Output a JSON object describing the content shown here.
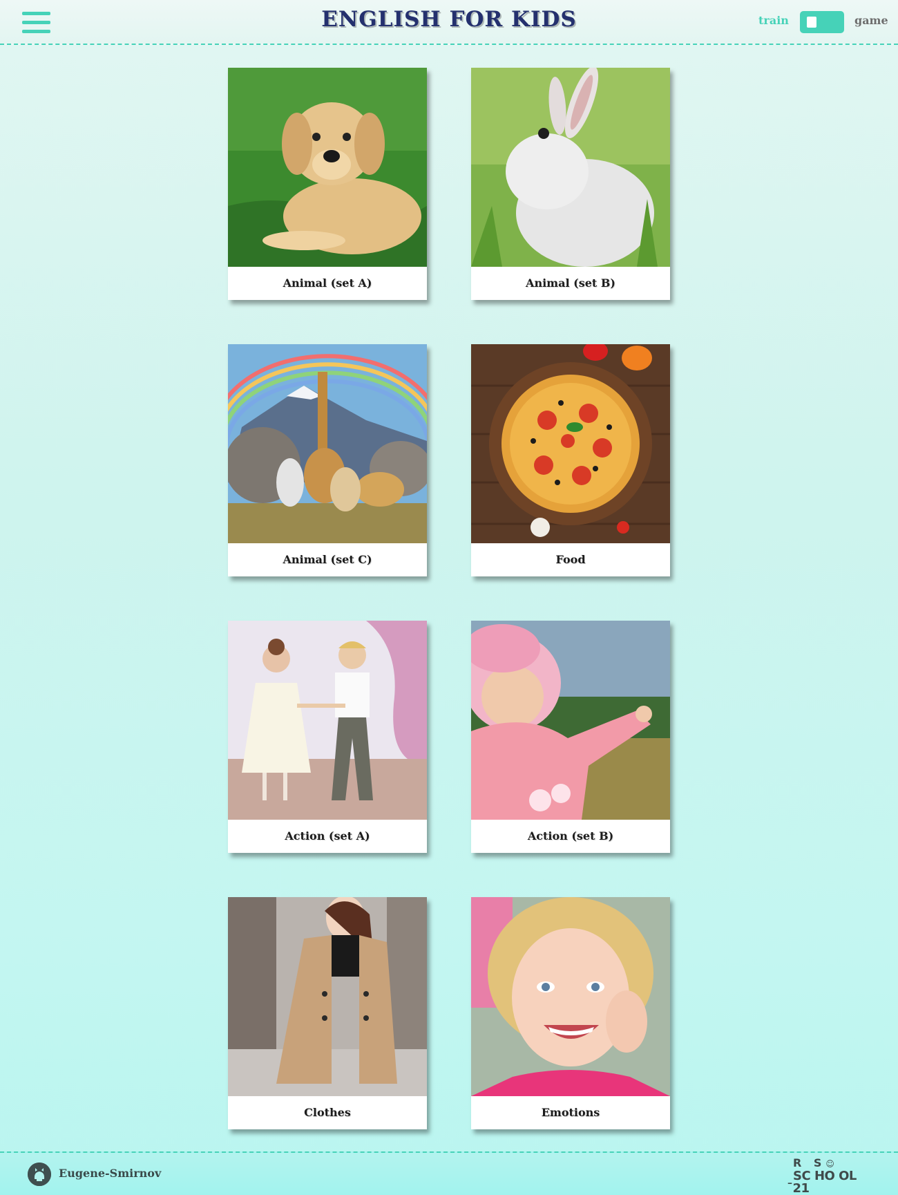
{
  "header": {
    "menu_icon": "hamburger-menu-icon",
    "logo_text": "ENGLISH FOR KIDS",
    "mode": {
      "train_label": "train",
      "game_label": "game",
      "current": "train"
    }
  },
  "categories": [
    {
      "label": "Animal (set A)",
      "image": "golden-retriever-puppy-on-grass"
    },
    {
      "label": "Animal (set B)",
      "image": "white-bunny-in-grass"
    },
    {
      "label": "Animal (set C)",
      "image": "safari-animals-with-rainbow"
    },
    {
      "label": "Food",
      "image": "pizza-on-wooden-board"
    },
    {
      "label": "Action (set A)",
      "image": "children-dancing"
    },
    {
      "label": "Action (set B)",
      "image": "girl-in-pink-pointing"
    },
    {
      "label": "Clothes",
      "image": "woman-in-beige-coat"
    },
    {
      "label": "Emotions",
      "image": "smiling-girl"
    }
  ],
  "footer": {
    "github_icon": "github-icon",
    "author": "Eugene-Smirnov",
    "school_logo_text": "RS SCHOOL 21"
  },
  "colors": {
    "accent": "#46d2b8",
    "inactive_mode": "#6d6d6d",
    "card_background": "#ffffff"
  }
}
